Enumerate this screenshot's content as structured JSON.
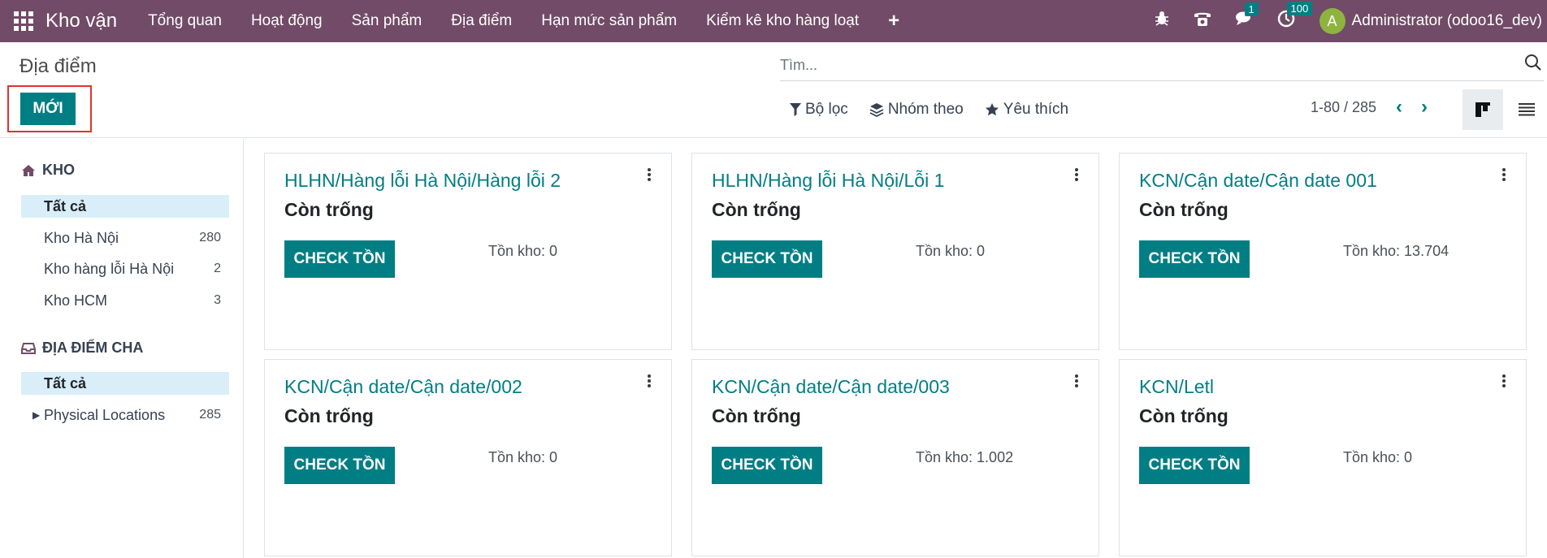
{
  "navbar": {
    "app_name": "Kho vận",
    "menu": [
      "Tổng quan",
      "Hoạt động",
      "Sản phẩm",
      "Địa điểm",
      "Hạn mức sản phẩm",
      "Kiểm kê kho hàng loạt"
    ],
    "plus": "+",
    "messages_badge": "1",
    "activity_badge": "100",
    "avatar_letter": "A",
    "user_name": "Administrator (odoo16_dev)"
  },
  "control_panel": {
    "breadcrumb": "Địa điểm",
    "new_button": "MỚI",
    "search_placeholder": "Tìm...",
    "filter_label": "Bộ lọc",
    "group_label": "Nhóm theo",
    "favorite_label": "Yêu thích",
    "pager": "1-80 / 285",
    "prev": "‹",
    "next": "›"
  },
  "sidebar": {
    "warehouse_header": "KHO",
    "warehouse_items": [
      {
        "label": "Tất cả",
        "count": ""
      },
      {
        "label": "Kho Hà Nội",
        "count": "280"
      },
      {
        "label": "Kho hàng lỗi Hà Nội",
        "count": "2"
      },
      {
        "label": "Kho HCM",
        "count": "3"
      }
    ],
    "parent_header": "ĐỊA ĐIỂM CHA",
    "parent_items": [
      {
        "label": "Tất cả",
        "count": ""
      },
      {
        "label": "Physical Locations",
        "count": "285"
      }
    ]
  },
  "cards": [
    {
      "title": "HLHN/Hàng lỗi Hà Nội/Hàng lỗi 2",
      "status": "Còn trống",
      "button": "CHECK TỒN",
      "stock": "Tồn kho: 0"
    },
    {
      "title": "HLHN/Hàng lỗi Hà Nội/Lỗi 1",
      "status": "Còn trống",
      "button": "CHECK TỒN",
      "stock": "Tồn kho: 0"
    },
    {
      "title": "KCN/Cận date/Cận date 001",
      "status": "Còn trống",
      "button": "CHECK TỒN",
      "stock": "Tồn kho: 13.704"
    },
    {
      "title": "KCN/Cận date/Cận date/002",
      "status": "Còn trống",
      "button": "CHECK TỒN",
      "stock": "Tồn kho: 0"
    },
    {
      "title": "KCN/Cận date/Cận date/003",
      "status": "Còn trống",
      "button": "CHECK TỒN",
      "stock": "Tồn kho: 1.002"
    },
    {
      "title": "KCN/Letl",
      "status": "Còn trống",
      "button": "CHECK TỒN",
      "stock": "Tồn kho: 0"
    }
  ]
}
